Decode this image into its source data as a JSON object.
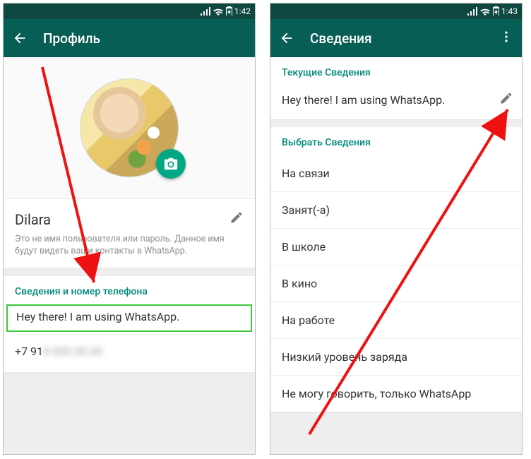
{
  "left": {
    "statusbar": {
      "time": "1:42"
    },
    "appbar": {
      "title": "Профиль"
    },
    "profile": {
      "name": "Dilara",
      "helper": "Это не имя пользователя или пароль. Данное имя будут видеть ваши контакты в WhatsApp.",
      "section_label": "Сведения и номер телефона",
      "status": "Hey there! I am using WhatsApp.",
      "phone_prefix": "+7 91",
      "phone_hidden": "0 000 00 00"
    }
  },
  "right": {
    "statusbar": {
      "time": "1:43"
    },
    "appbar": {
      "title": "Сведения"
    },
    "current_label": "Текущие Сведения",
    "current_value": "Hey there! I am using WhatsApp.",
    "choose_label": "Выбрать Сведения",
    "options": [
      "На связи",
      "Занят(-а)",
      "В школе",
      "В кино",
      "На работе",
      "Низкий уровень заряда",
      "Не могу говорить, только WhatsApp"
    ]
  }
}
